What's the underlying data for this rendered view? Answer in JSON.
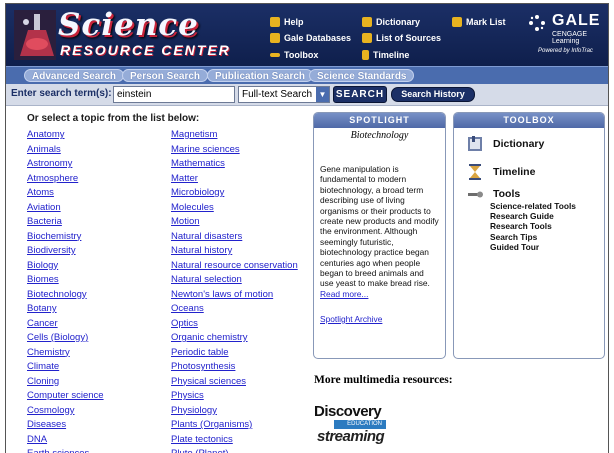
{
  "header": {
    "logo_title": "Science",
    "logo_subtitle": "RESOURCE CENTER",
    "links": {
      "help": "Help",
      "gale_databases": "Gale Databases",
      "toolbox": "Toolbox",
      "dictionary": "Dictionary",
      "list_of_sources": "List of Sources",
      "timeline": "Timeline",
      "mark_list": "Mark List"
    },
    "brand": {
      "name": "GALE",
      "sub": "CENGAGE Learning",
      "powered": "Powered by InfoTrac"
    }
  },
  "tabs": [
    "Advanced Search",
    "Person Search",
    "Publication Search",
    "Science Standards"
  ],
  "search": {
    "label": "Enter search term(s):",
    "value": "einstein",
    "mode": "Full-text Search",
    "button": "SEARCH",
    "history": "Search History"
  },
  "topics": {
    "title": "Or select a topic from the list below:",
    "col1": [
      "Anatomy",
      "Animals",
      "Astronomy",
      "Atmosphere",
      "Atoms",
      "Aviation",
      "Bacteria",
      "Biochemistry",
      "Biodiversity",
      "Biology",
      "Biomes",
      "Biotechnology",
      "Botany",
      "Cancer",
      "Cells (Biology)",
      "Chemistry",
      "Climate",
      "Cloning",
      "Computer science",
      "Cosmology",
      "Diseases",
      "DNA",
      "Earth sciences"
    ],
    "col2": [
      "Magnetism",
      "Marine sciences",
      "Mathematics",
      "Matter",
      "Microbiology",
      "Molecules",
      "Motion",
      "Natural disasters",
      "Natural history",
      "Natural resource conservation",
      "Natural selection",
      "Newton's laws of motion",
      "Oceans",
      "Optics",
      "Organic chemistry",
      "Periodic table",
      "Photosynthesis",
      "Physical sciences",
      "Physics",
      "Physiology",
      "Plants (Organisms)",
      "Plate tectonics",
      "Pluto (Planet)"
    ]
  },
  "spotlight": {
    "heading": "SPOTLIGHT",
    "topic": "Biotechnology",
    "text": "Gene manipulation is fundamental to modern biotechnology, a broad term describing use of living organisms or their products to create new products and modify the environment. Although seemingly futuristic, biotechnology practice began centuries ago when people began to breed animals and use yeast to make bread rise.",
    "read_more": "Read more...",
    "archive": "Spotlight Archive"
  },
  "toolbox": {
    "heading": "TOOLBOX",
    "dictionary": "Dictionary",
    "timeline": "Timeline",
    "tools": "Tools",
    "tool_items": [
      "Science-related Tools",
      "Research Guide",
      "Research Tools",
      "Search Tips",
      "Guided Tour"
    ]
  },
  "multimedia": {
    "title": "More multimedia resources:",
    "discovery": "Discovery",
    "education": "EDUCATION",
    "streaming": "streaming"
  }
}
